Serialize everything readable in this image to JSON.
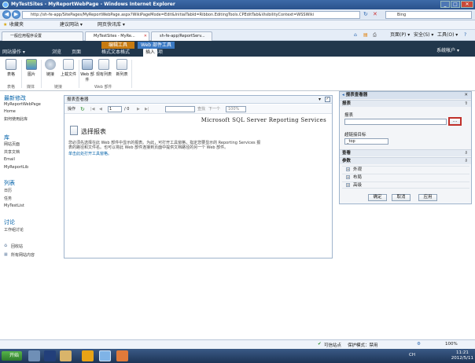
{
  "window": {
    "title": "MyTestSites - MyReportWebPage - Windows Internet Explorer",
    "min": "_",
    "max": "□",
    "close": "✕"
  },
  "address": {
    "url": "http://sh-fe-app/SitePages/MyReportWebPage.aspx?WikiPageMode=Edit&InitialTabId=Ribbon.EditingTools.CPEditTab&VisibilityContext=WSSWiki",
    "search_text": "Bing"
  },
  "favorites": {
    "label": "收藏夹",
    "items": [
      "建议网站 ▾",
      "网页快讯库 ▾"
    ]
  },
  "browser_tabs": [
    {
      "label": "一般应用程序设置"
    },
    {
      "label": "MyTestSites - MyRe..."
    },
    {
      "label": "sh-fe-app/ReportServ..."
    }
  ],
  "command_bar": {
    "page": "页面(P) ▾",
    "safety": "安全(S) ▾",
    "tools": "工具(O) ▾",
    "help": "?"
  },
  "ribbon": {
    "context_groups": [
      "编辑工具",
      "Web 部件工具"
    ],
    "tabs": [
      "网站操作 ▾",
      "浏览",
      "页面",
      "格式文本格式",
      "插入",
      "选项"
    ],
    "system_account": "系统帐户 ▾",
    "buttons": [
      {
        "label": "表格"
      },
      {
        "label": "图片"
      },
      {
        "label": "链接"
      },
      {
        "label": "上载文件"
      },
      {
        "label": "Web 部件"
      },
      {
        "label": "现有列表"
      },
      {
        "label": "新列表"
      }
    ],
    "groups": [
      "表格",
      "媒体",
      "链接",
      "Web 部件"
    ]
  },
  "leftnav": {
    "recent_header": "最新修改",
    "recent_items": [
      "MyReportWebPage",
      "Home",
      "如何使用此库"
    ],
    "libraries_header": "库",
    "libraries": [
      "网站页面",
      "共享文档",
      "Email",
      "MyReportLib"
    ],
    "lists_header": "列表",
    "lists": [
      "日历",
      "任务",
      "MyTestList"
    ],
    "discussions_header": "讨论",
    "discussions": [
      "工作组讨论"
    ],
    "recycle_bin": "回收站",
    "all_content": "所有网站内容"
  },
  "report_viewer": {
    "title": "报表查看器",
    "toolbar_actions": "操作",
    "page_value": "1",
    "page_of": "/ 0",
    "find_label": "查找",
    "next_label": "下一个",
    "zoom": "100%",
    "brand": "Microsoft SQL Server Reporting Services",
    "choose_heading": "选择报表",
    "instructions": "您必须先选择在此 Web 部件中显示的报表。为此，可打开工具窗格，指定您要显示的 Reporting Services 报表的路径和文件名。也可以将此 Web 部件连接到页面中提供文档路径的另一个 Web 部件。",
    "open_tool_pane_link": "单击此处打开工具窗格。"
  },
  "tool_pane": {
    "title": "报表查看器",
    "report_section": "报表",
    "report_label": "报表",
    "report_value": "",
    "browse_button": "...",
    "hyperlink_label": "超链接目标",
    "hyperlink_value": "_top",
    "view_section": "查看",
    "params_section": "参数",
    "sub_sections": [
      "外观",
      "布局",
      "高级"
    ],
    "ok": "确定",
    "cancel": "取消",
    "apply": "应用"
  },
  "status_bar": {
    "zone": "可信站点",
    "protected_mode": "保护模式：禁用",
    "zoom": "100%"
  },
  "taskbar": {
    "start": "开始",
    "language": "CH",
    "time": "11:21",
    "date": "2012/5/11"
  }
}
